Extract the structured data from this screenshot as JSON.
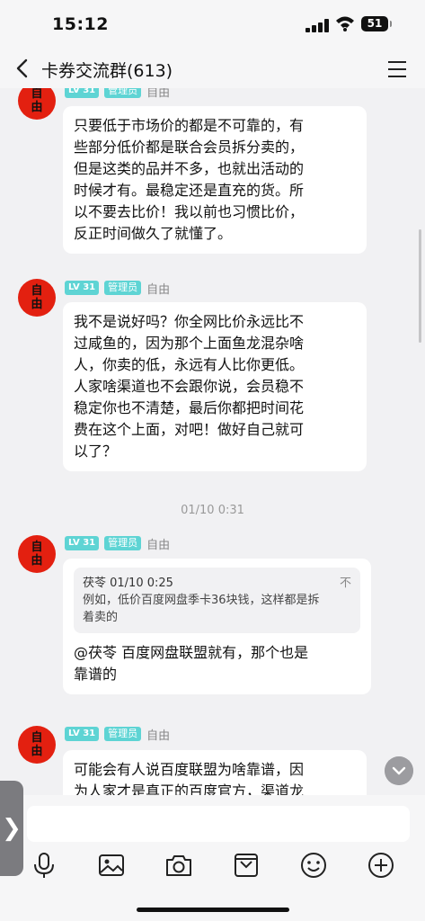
{
  "status_bar": {
    "time": "15:12",
    "battery": "51"
  },
  "header": {
    "title": "卡券交流群(613)"
  },
  "messages": [
    {
      "avatar_text": "自\n由",
      "level": "LV 31",
      "role": "管理员",
      "name": "自由",
      "lines": [
        "只要低于市场价的都是不可靠的，有",
        "些部分低价都是联合会员拆分卖的，",
        "但是这类的品并不多，也就出活动的",
        "时候才有。最稳定还是直充的货。所",
        "以不要去比价！我以前也习惯比价，",
        "反正时间做久了就懂了。"
      ]
    },
    {
      "avatar_text": "自\n由",
      "level": "LV 31",
      "role": "管理员",
      "name": "自由",
      "lines": [
        "我不是说好吗？你全网比价永远比不",
        "过咸鱼的，因为那个上面鱼龙混杂啥",
        "人，你卖的低，永远有人比你更低。",
        "人家啥渠道也不会跟你说，会员稳不",
        "稳定你也不清楚，最后你都把时间花",
        "费在这个上面，对吧！做好自己就可",
        "以了？"
      ]
    },
    {
      "avatar_text": "自\n由",
      "level": "LV 31",
      "role": "管理员",
      "name": "自由",
      "quote_header": "茯苓 01/10 0:25",
      "quote_close": "不",
      "quote_lines": [
        "例如，低价百度网盘季卡36块钱，这样都是拆",
        "着卖的"
      ],
      "lines": [
        "@茯苓 百度网盘联盟就有，那个也是",
        "靠谱的"
      ]
    },
    {
      "avatar_text": "自\n由",
      "level": "LV 31",
      "role": "管理员",
      "name": "自由",
      "lines": [
        "可能会有人说百度联盟为啥靠谱，因",
        "为人家才是真正的百度官方，渠道龙"
      ]
    }
  ],
  "timestamp": "01/10 0:31",
  "side_tab": "❯",
  "toolbar_icons": [
    "microphone-icon",
    "image-icon",
    "camera-icon",
    "pocket-icon",
    "emoji-icon",
    "plus-icon"
  ]
}
